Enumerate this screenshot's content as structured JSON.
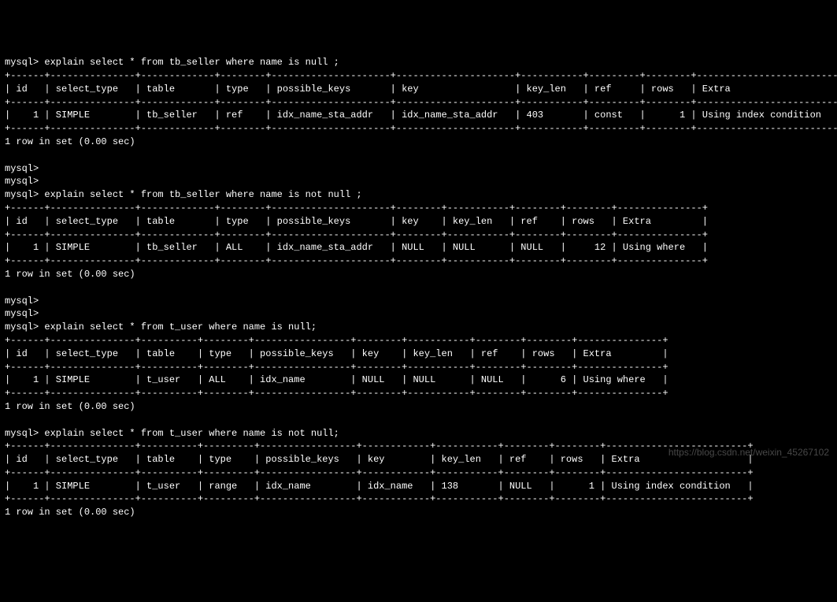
{
  "prompt": "mysql>",
  "empty_prompt": "mysql>",
  "result_msg": "1 row in set (0.00 sec)",
  "watermark": "https://blog.csdn.net/weixin_45267102",
  "queries": [
    {
      "command": "explain select * from tb_seller where name is null ;",
      "headers": [
        "id",
        "select_type",
        "table",
        "type",
        "possible_keys",
        "key",
        "key_len",
        "ref",
        "rows",
        "Extra"
      ],
      "row": [
        "1",
        "SIMPLE",
        "tb_seller",
        "ref",
        "idx_name_sta_addr",
        "idx_name_sta_addr",
        "403",
        "const",
        "1",
        "Using index condition"
      ],
      "widths": [
        4,
        13,
        11,
        6,
        19,
        19,
        9,
        7,
        6,
        23
      ],
      "align": [
        "r",
        "l",
        "l",
        "l",
        "l",
        "l",
        "l",
        "l",
        "r",
        "l"
      ],
      "blank_prompts_before": 0
    },
    {
      "command": "explain select * from tb_seller where name is not null ;",
      "headers": [
        "id",
        "select_type",
        "table",
        "type",
        "possible_keys",
        "key",
        "key_len",
        "ref",
        "rows",
        "Extra"
      ],
      "row": [
        "1",
        "SIMPLE",
        "tb_seller",
        "ALL",
        "idx_name_sta_addr",
        "NULL",
        "NULL",
        "NULL",
        "12",
        "Using where"
      ],
      "widths": [
        4,
        13,
        11,
        6,
        19,
        6,
        9,
        6,
        6,
        13
      ],
      "align": [
        "r",
        "l",
        "l",
        "l",
        "l",
        "l",
        "l",
        "l",
        "r",
        "l"
      ],
      "blank_prompts_before": 2
    },
    {
      "command": "explain select * from t_user where name is null;",
      "headers": [
        "id",
        "select_type",
        "table",
        "type",
        "possible_keys",
        "key",
        "key_len",
        "ref",
        "rows",
        "Extra"
      ],
      "row": [
        "1",
        "SIMPLE",
        "t_user",
        "ALL",
        "idx_name",
        "NULL",
        "NULL",
        "NULL",
        "6",
        "Using where"
      ],
      "widths": [
        4,
        13,
        8,
        6,
        15,
        6,
        9,
        6,
        6,
        13
      ],
      "align": [
        "r",
        "l",
        "l",
        "l",
        "l",
        "l",
        "l",
        "l",
        "r",
        "l"
      ],
      "blank_prompts_before": 2
    },
    {
      "command": "explain select * from t_user where name is not null;",
      "headers": [
        "id",
        "select_type",
        "table",
        "type",
        "possible_keys",
        "key",
        "key_len",
        "ref",
        "rows",
        "Extra"
      ],
      "row": [
        "1",
        "SIMPLE",
        "t_user",
        "range",
        "idx_name",
        "idx_name",
        "138",
        "NULL",
        "1",
        "Using index condition"
      ],
      "widths": [
        4,
        13,
        8,
        7,
        15,
        10,
        9,
        6,
        6,
        23
      ],
      "align": [
        "r",
        "l",
        "l",
        "l",
        "l",
        "l",
        "l",
        "l",
        "r",
        "l"
      ],
      "blank_prompts_before": 0
    }
  ]
}
